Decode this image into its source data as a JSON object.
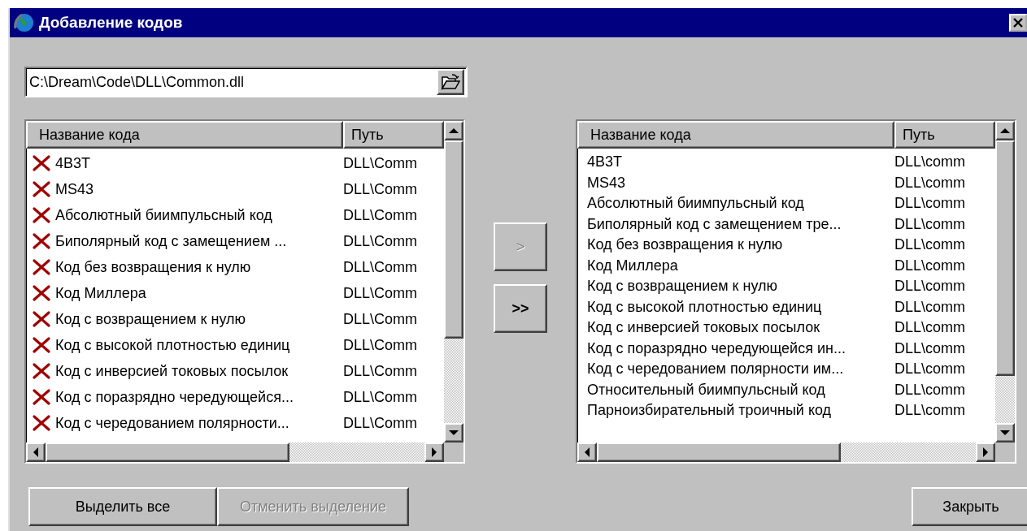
{
  "window": {
    "title": "Добавление кодов"
  },
  "path_field": {
    "value": "C:\\Dream\\Code\\DLL\\Common.dll"
  },
  "source_list": {
    "columns": [
      "Название кода",
      "Путь"
    ],
    "rows": [
      {
        "name": "4B3T",
        "path": "DLL\\Comm",
        "invalid": true
      },
      {
        "name": "MS43",
        "path": "DLL\\Comm",
        "invalid": true
      },
      {
        "name": "Абсолютный биимпульсный код",
        "path": "DLL\\Comm",
        "invalid": true
      },
      {
        "name": "Биполярный код с замещением ...",
        "path": "DLL\\Comm",
        "invalid": true
      },
      {
        "name": "Код без возвращения к нулю",
        "path": "DLL\\Comm",
        "invalid": true
      },
      {
        "name": "Код Миллера",
        "path": "DLL\\Comm",
        "invalid": true
      },
      {
        "name": "Код с возвращением к нулю",
        "path": "DLL\\Comm",
        "invalid": true
      },
      {
        "name": "Код с высокой плотностью единиц",
        "path": "DLL\\Comm",
        "invalid": true
      },
      {
        "name": "Код с инверсией токовых посылок",
        "path": "DLL\\Comm",
        "invalid": true
      },
      {
        "name": "Код с поразрядно чередующейся...",
        "path": "DLL\\Comm",
        "invalid": true
      },
      {
        "name": "Код с чередованием полярности...",
        "path": "DLL\\Comm",
        "invalid": true
      }
    ]
  },
  "transfer_buttons": [
    {
      "label": ">",
      "disabled": true
    },
    {
      "label": ">>",
      "disabled": false
    }
  ],
  "target_list": {
    "columns": [
      "Название кода",
      "Путь"
    ],
    "rows": [
      {
        "name": "4B3T",
        "path": "DLL\\comm"
      },
      {
        "name": "MS43",
        "path": "DLL\\comm"
      },
      {
        "name": "Абсолютный биимпульсный код",
        "path": "DLL\\comm"
      },
      {
        "name": "Биполярный код с замещением тре...",
        "path": "DLL\\comm"
      },
      {
        "name": "Код без возвращения к нулю",
        "path": "DLL\\comm"
      },
      {
        "name": "Код Миллера",
        "path": "DLL\\comm"
      },
      {
        "name": "Код с возвращением к нулю",
        "path": "DLL\\comm"
      },
      {
        "name": "Код с высокой плотностью единиц",
        "path": "DLL\\comm"
      },
      {
        "name": "Код с инверсией токовых посылок",
        "path": "DLL\\comm"
      },
      {
        "name": "Код с поразрядно чередующейся ин...",
        "path": "DLL\\comm"
      },
      {
        "name": "Код с чередованием полярности им...",
        "path": "DLL\\comm"
      },
      {
        "name": "Относительный биимпульсный код",
        "path": "DLL\\comm"
      },
      {
        "name": "Парноизбирательный троичный код",
        "path": "DLL\\comm"
      }
    ]
  },
  "buttons": [
    {
      "label": "Выделить все",
      "disabled": false
    },
    {
      "label": "Отменить выделение",
      "disabled": true
    },
    {
      "label": "Закрыть",
      "disabled": false
    }
  ]
}
